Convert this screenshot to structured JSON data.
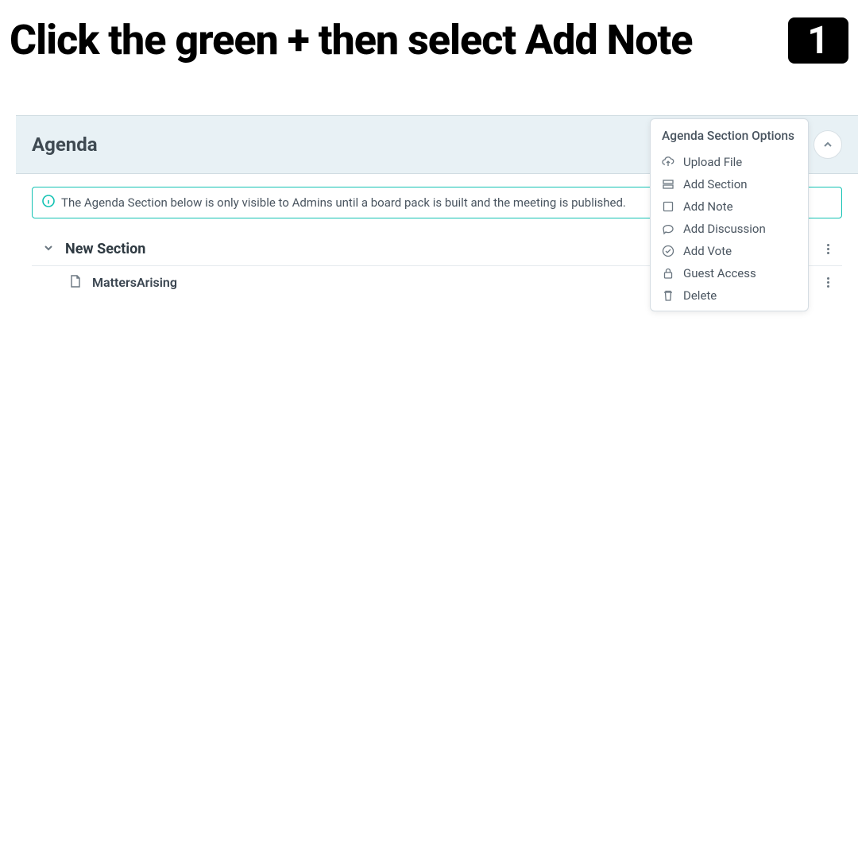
{
  "instruction": {
    "text": "Click the green + then select Add Note",
    "step": "1"
  },
  "agenda": {
    "title": "Agenda",
    "info_text": "The Agenda Section below is only visible to Admins until a board pack is built and the meeting is published.",
    "section": {
      "title": "New Section"
    },
    "item": {
      "label": "MattersArising"
    }
  },
  "dropdown": {
    "title": "Agenda Section Options",
    "items": [
      {
        "icon": "cloud-up",
        "label": "Upload File"
      },
      {
        "icon": "sections",
        "label": "Add Section"
      },
      {
        "icon": "note",
        "label": "Add Note"
      },
      {
        "icon": "chat",
        "label": "Add Discussion"
      },
      {
        "icon": "check-circle",
        "label": "Add Vote"
      },
      {
        "icon": "lock",
        "label": "Guest Access"
      },
      {
        "icon": "trash",
        "label": "Delete"
      }
    ]
  }
}
